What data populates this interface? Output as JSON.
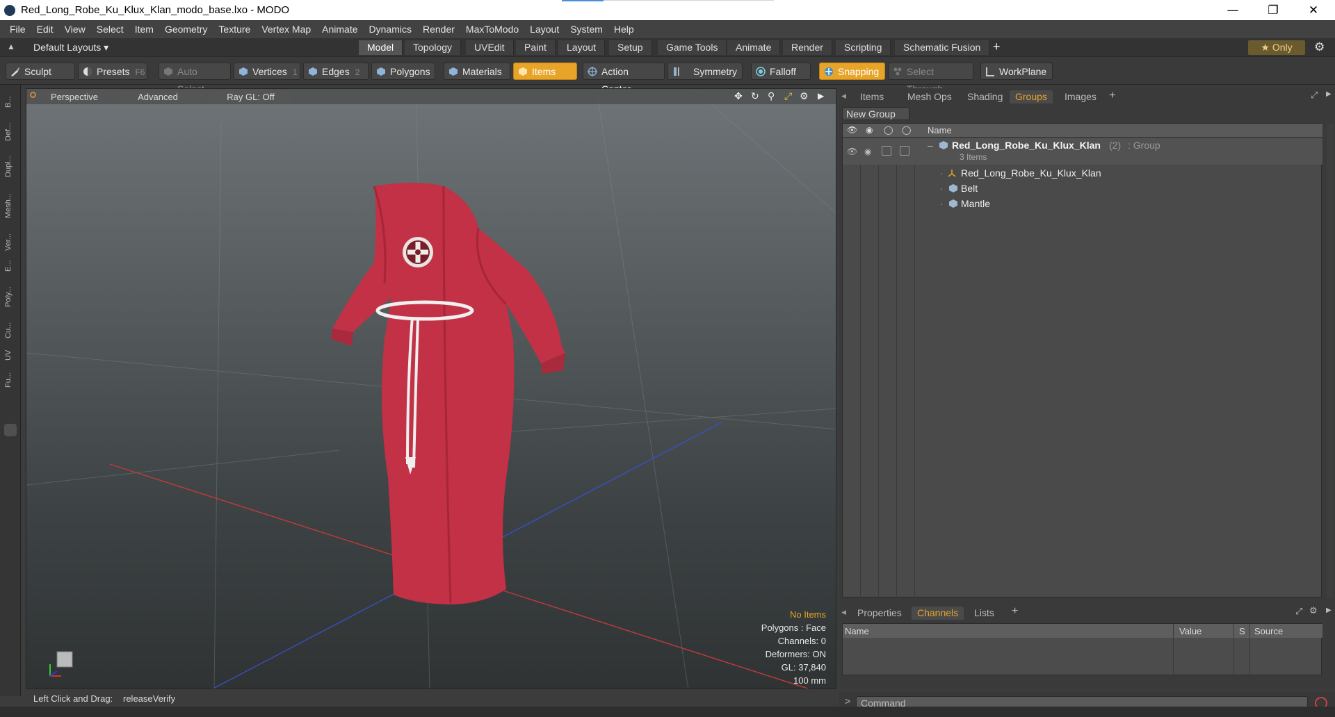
{
  "window": {
    "title": "Red_Long_Robe_Ku_Klux_Klan_modo_base.lxo - MODO",
    "minimize": "—",
    "restore": "❐",
    "close": "✕"
  },
  "menu": [
    "File",
    "Edit",
    "View",
    "Select",
    "Item",
    "Geometry",
    "Texture",
    "Vertex Map",
    "Animate",
    "Dynamics",
    "Render",
    "MaxToModo",
    "Layout",
    "System",
    "Help"
  ],
  "layouts": {
    "default_layouts": "Default Layouts ▾",
    "tabs": [
      "Model",
      "Topology",
      "UVEdit",
      "Paint",
      "Layout",
      "Setup",
      "Game Tools",
      "Animate",
      "Render",
      "Scripting",
      "Schematic Fusion"
    ],
    "add": "+",
    "only": "★ Only"
  },
  "toolbar": {
    "sculpt": "Sculpt",
    "presets": "Presets",
    "presets_key": "F6",
    "auto_select": "Auto Select",
    "vertices": "Vertices",
    "vertices_num": "1",
    "edges": "Edges",
    "edges_num": "2",
    "polygons": "Polygons",
    "materials": "Materials",
    "items": "Items",
    "action_center": "Action Center",
    "symmetry": "Symmetry",
    "falloff": "Falloff",
    "snapping": "Snapping",
    "select_through": "Select Through",
    "workplane": "WorkPlane"
  },
  "left_strip": [
    "B...",
    "Def...",
    "Dupl...",
    "Mesh...",
    "Ver...",
    "E...",
    "Poly...",
    "Cu...",
    "UV",
    "Fu..."
  ],
  "viewport": {
    "perspective": "Perspective",
    "advanced": "Advanced",
    "raygl": "Ray GL: Off",
    "info": {
      "items": "No Items",
      "polygons": "Polygons : Face",
      "channels": "Channels: 0",
      "deformers": "Deformers: ON",
      "gl": "GL: 37,840",
      "scale": "100 mm"
    }
  },
  "right_panel": {
    "tabs": [
      "Items",
      "Mesh Ops",
      "Shading",
      "Groups",
      "Images"
    ],
    "active_tab": "Groups",
    "new_group": "New Group",
    "col_name": "Name",
    "group": {
      "name": "Red_Long_Robe_Ku_Klux_Klan",
      "count": "(2)",
      "type": ": Group",
      "sub": "3 Items",
      "children": [
        "Red_Long_Robe_Ku_Klux_Klan",
        "Belt",
        "Mantle"
      ]
    },
    "bottom_tabs": [
      "Properties",
      "Channels",
      "Lists"
    ],
    "bottom_active": "Channels",
    "channels_cols": {
      "name": "Name",
      "value": "Value",
      "s": "S",
      "source": "Source"
    },
    "command_placeholder": "Command"
  },
  "status": {
    "left": "Left Click and Drag:",
    "right": "releaseVerify"
  },
  "colors": {
    "accent": "#e8a428",
    "robe": "#c23145"
  }
}
